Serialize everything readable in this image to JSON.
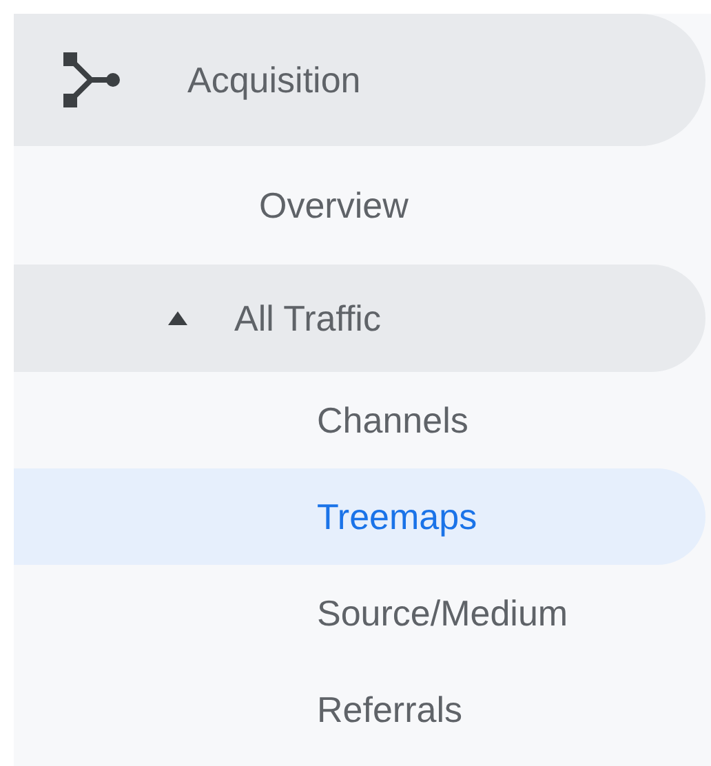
{
  "sidebar": {
    "items": [
      {
        "label": "Acquisition",
        "kind": "group",
        "expanded": true,
        "children": [
          {
            "label": "Overview",
            "kind": "link",
            "selected": false
          },
          {
            "label": "All Traffic",
            "kind": "group",
            "expanded": true,
            "children": [
              {
                "label": "Channels",
                "kind": "link",
                "selected": false
              },
              {
                "label": "Treemaps",
                "kind": "link",
                "selected": true
              },
              {
                "label": "Source/Medium",
                "kind": "link",
                "selected": false
              },
              {
                "label": "Referrals",
                "kind": "link",
                "selected": false
              }
            ]
          }
        ]
      }
    ]
  }
}
